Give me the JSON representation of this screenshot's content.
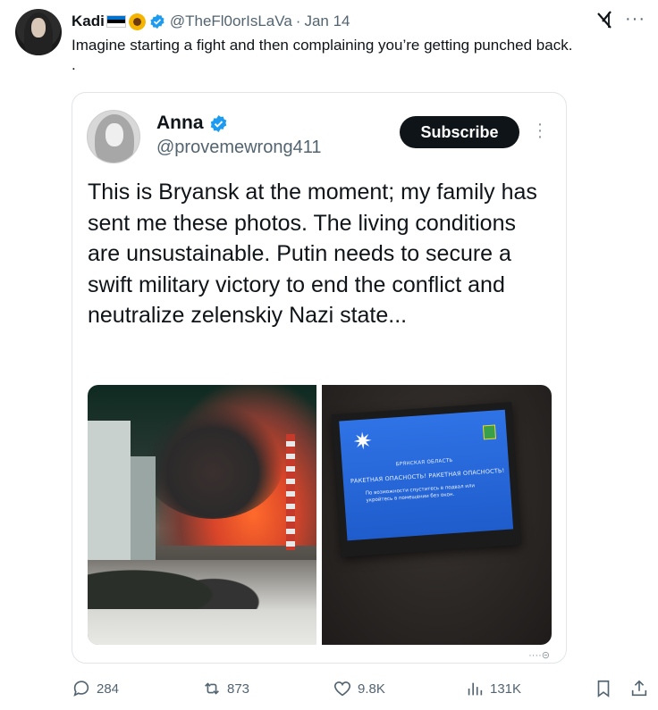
{
  "tweet": {
    "author_name": "Kadi",
    "author_handle": "@TheFl0orIsLaVa",
    "separator": "·",
    "date": "Jan 14",
    "text": "Imagine starting a fight and then complaining you’re getting punched back.",
    "text_line2": "."
  },
  "quoted": {
    "name": "Anna",
    "handle": "@provemewrong411",
    "subscribe_label": "Subscribe",
    "text": "This is Bryansk at the moment; my family has sent me these photos. The living conditions are unsustainable. Putin needs to secure a swift military victory to end the conflict and neutralize zelenskiy Nazi state...",
    "photo_screen": {
      "line1": "БРЯНСКАЯ ОБЛАСТЬ",
      "line2": "РАКЕТНАЯ ОПАСНОСТЬ! РАКЕТНАЯ ОПАСНОСТЬ!",
      "line3": "По возможности спуститесь в подвал или",
      "line4": "укройтесь в помещении без окон."
    }
  },
  "actions": {
    "replies": "284",
    "reposts": "873",
    "likes": "9.8K",
    "views": "131K"
  },
  "colors": {
    "verified": "#1d9bf0",
    "text_secondary": "#536471",
    "subscribe_bg": "#0f1419"
  },
  "icons": [
    "grok-icon",
    "more-icon",
    "verified-icon",
    "reply-icon",
    "repost-icon",
    "like-icon",
    "views-icon",
    "bookmark-icon",
    "share-icon"
  ]
}
